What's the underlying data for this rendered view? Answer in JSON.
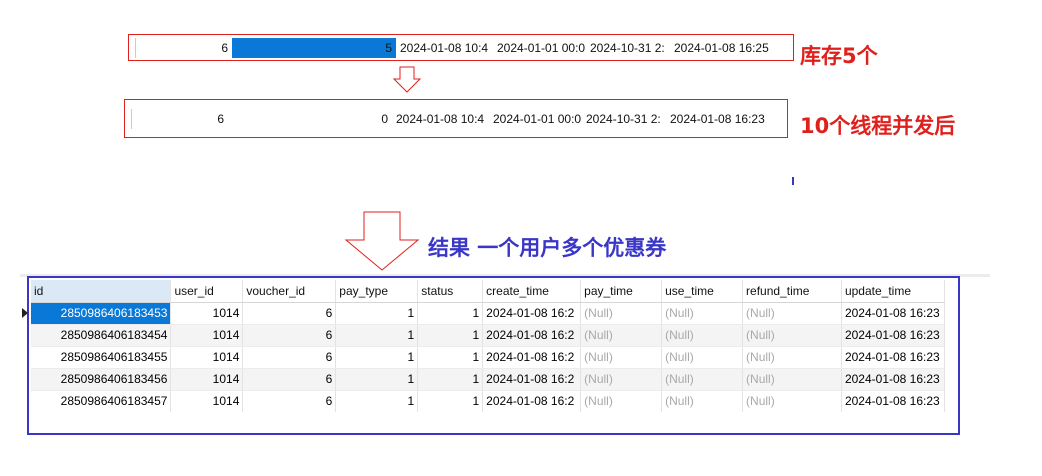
{
  "before_row": {
    "cells": [
      "6",
      "5",
      "2024-01-08 10:4",
      "2024-01-01 00:0",
      "2024-10-31 2:",
      "2024-01-08 16:25"
    ]
  },
  "after_row": {
    "cells": [
      "6",
      "0",
      "2024-01-08 10:4",
      "2024-01-01 00:0",
      "2024-10-31 2:",
      "2024-01-08 16:23"
    ]
  },
  "annotations": {
    "stock": "库存5个",
    "threads": "10个线程并发后",
    "result": "结果 一个用户多个优惠券"
  },
  "table": {
    "columns": [
      "id",
      "user_id",
      "voucher_id",
      "pay_type",
      "status",
      "create_time",
      "pay_time",
      "use_time",
      "refund_time",
      "update_time"
    ],
    "rows": [
      [
        "2850986406183453",
        "1014",
        "6",
        "1",
        "1",
        "2024-01-08 16:2",
        "(Null)",
        "(Null)",
        "(Null)",
        "2024-01-08 16:23"
      ],
      [
        "2850986406183454",
        "1014",
        "6",
        "1",
        "1",
        "2024-01-08 16:2",
        "(Null)",
        "(Null)",
        "(Null)",
        "2024-01-08 16:23"
      ],
      [
        "2850986406183455",
        "1014",
        "6",
        "1",
        "1",
        "2024-01-08 16:2",
        "(Null)",
        "(Null)",
        "(Null)",
        "2024-01-08 16:23"
      ],
      [
        "2850986406183456",
        "1014",
        "6",
        "1",
        "1",
        "2024-01-08 16:2",
        "(Null)",
        "(Null)",
        "(Null)",
        "2024-01-08 16:23"
      ],
      [
        "2850986406183457",
        "1014",
        "6",
        "1",
        "1",
        "2024-01-08 16:2",
        "(Null)",
        "(Null)",
        "(Null)",
        "2024-01-08 16:23"
      ]
    ]
  },
  "colors": {
    "red_annotation": "#e0201c",
    "blue_annotation": "#3a36c8",
    "selection": "#0a78d7"
  }
}
